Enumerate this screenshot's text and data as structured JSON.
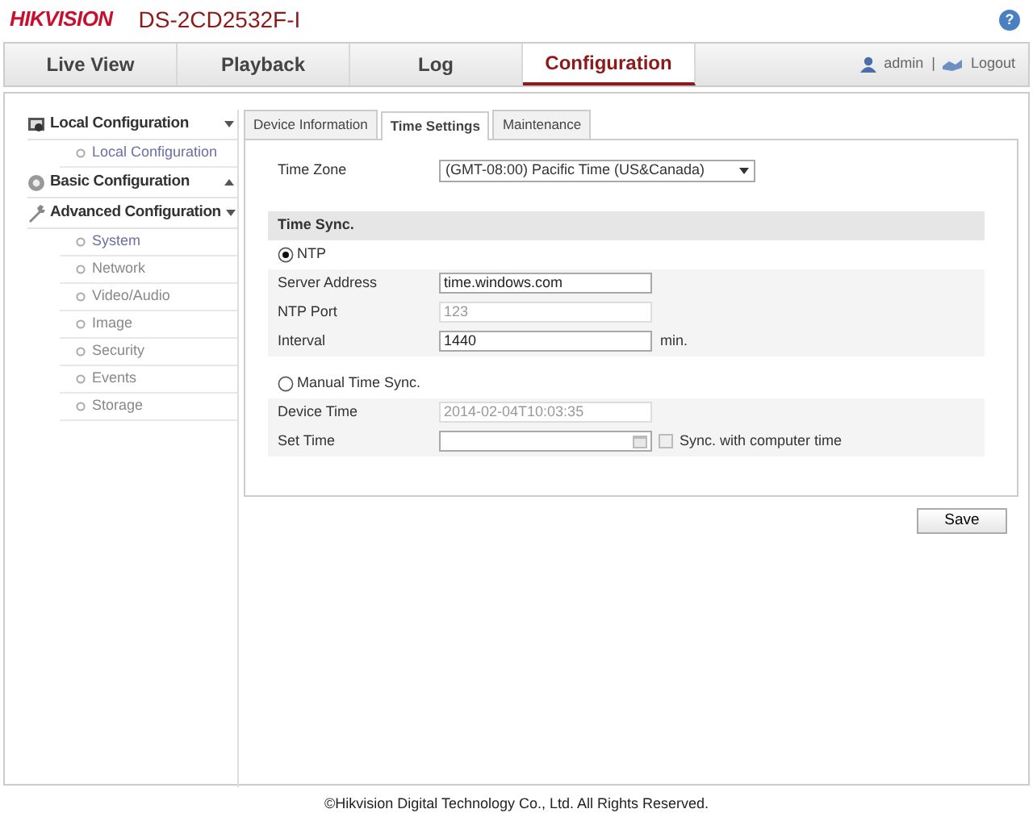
{
  "header": {
    "brand": "HIKVISION",
    "model": "DS-2CD2532F-I",
    "help": "?"
  },
  "nav": {
    "tabs": [
      {
        "label": "Live View",
        "selected": false
      },
      {
        "label": "Playback",
        "selected": false
      },
      {
        "label": "Log",
        "selected": false
      },
      {
        "label": "Configuration",
        "selected": true
      }
    ],
    "user": "admin",
    "separator": "|",
    "logout": "Logout"
  },
  "sidebar": {
    "groups": [
      {
        "label": "Local Configuration",
        "expanded": true,
        "children": [
          {
            "label": "Local Configuration",
            "selected": true
          }
        ]
      },
      {
        "label": "Basic Configuration",
        "expanded": false
      },
      {
        "label": "Advanced Configuration",
        "expanded": true,
        "children": [
          {
            "label": "System",
            "selected": true
          },
          {
            "label": "Network",
            "selected": false
          },
          {
            "label": "Video/Audio",
            "selected": false
          },
          {
            "label": "Image",
            "selected": false
          },
          {
            "label": "Security",
            "selected": false
          },
          {
            "label": "Events",
            "selected": false
          },
          {
            "label": "Storage",
            "selected": false
          }
        ]
      }
    ]
  },
  "subtabs": [
    {
      "label": "Device Information",
      "selected": false
    },
    {
      "label": "Time Settings",
      "selected": true
    },
    {
      "label": "Maintenance",
      "selected": false
    }
  ],
  "form": [
    {
      "kind": "select",
      "label": "Time Zone",
      "value": "(GMT-08:00) Pacific Time (US&Canada)"
    },
    {
      "kind": "section",
      "label": "Time Sync."
    },
    {
      "kind": "radio",
      "label": "NTP",
      "checked": true
    },
    {
      "kind": "field",
      "label": "Server Address",
      "value": "time.windows.com",
      "disabled": false
    },
    {
      "kind": "field",
      "label": "NTP Port",
      "value": "123",
      "disabled": true
    },
    {
      "kind": "field",
      "label": "Interval",
      "value": "1440",
      "disabled": false,
      "unit": "min."
    },
    {
      "kind": "radio",
      "label": "Manual Time Sync.",
      "checked": false
    },
    {
      "kind": "field",
      "label": "Device Time",
      "value": "2014-02-04T10:03:35",
      "disabled": true
    },
    {
      "kind": "datetime",
      "label": "Set Time",
      "checkbox_label": "Sync. with computer time",
      "checked": false
    }
  ],
  "save": "Save",
  "footer": "©Hikvision Digital Technology Co., Ltd. All Rights Reserved."
}
